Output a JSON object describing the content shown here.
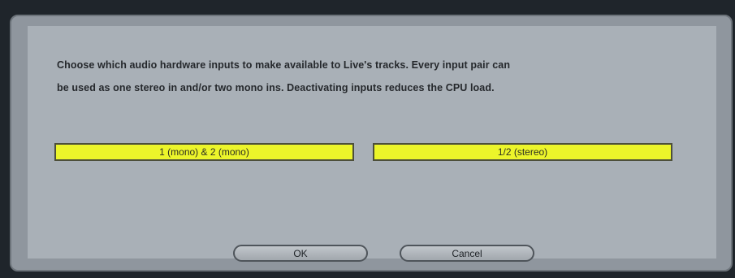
{
  "dialog": {
    "message_line1": "Choose which audio hardware inputs to make available to Live's tracks. Every input pair can",
    "message_line2": "be used as one stereo in and/or two mono ins.  Deactivating inputs reduces the CPU load.",
    "input_pairs": [
      {
        "label": "1 (mono) & 2 (mono)",
        "active": true
      },
      {
        "label": "1/2 (stereo)",
        "active": true
      }
    ],
    "ok_label": "OK",
    "cancel_label": "Cancel"
  },
  "colors": {
    "frame": "#1f252b",
    "panel": "#a9b0b7",
    "active_toggle": "#ecf52a"
  }
}
